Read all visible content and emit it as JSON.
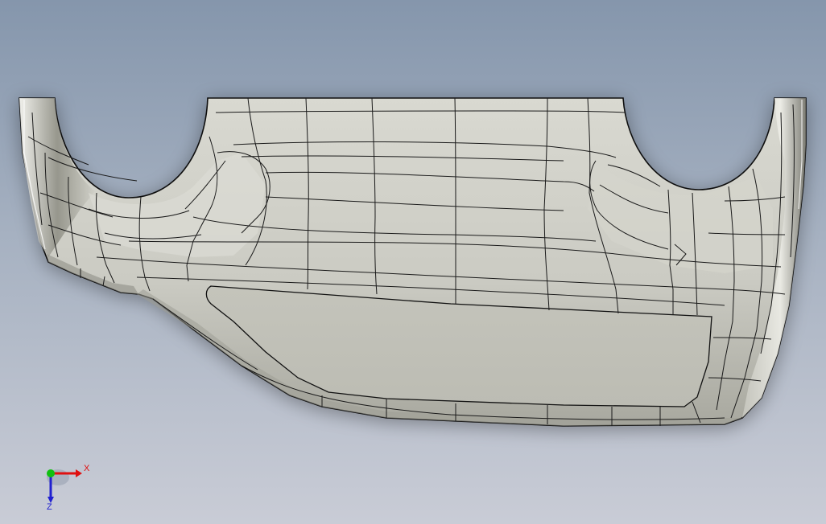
{
  "viewport": {
    "background_top": "#8596ac",
    "background_bottom": "#c9ccd6",
    "model_fill": "#c6c6be",
    "edge_color": "#111111"
  },
  "triad": {
    "x_label": "X",
    "z_label": "Z",
    "x_color": "#e01010",
    "y_color": "#10c010",
    "z_color": "#2020d0"
  }
}
